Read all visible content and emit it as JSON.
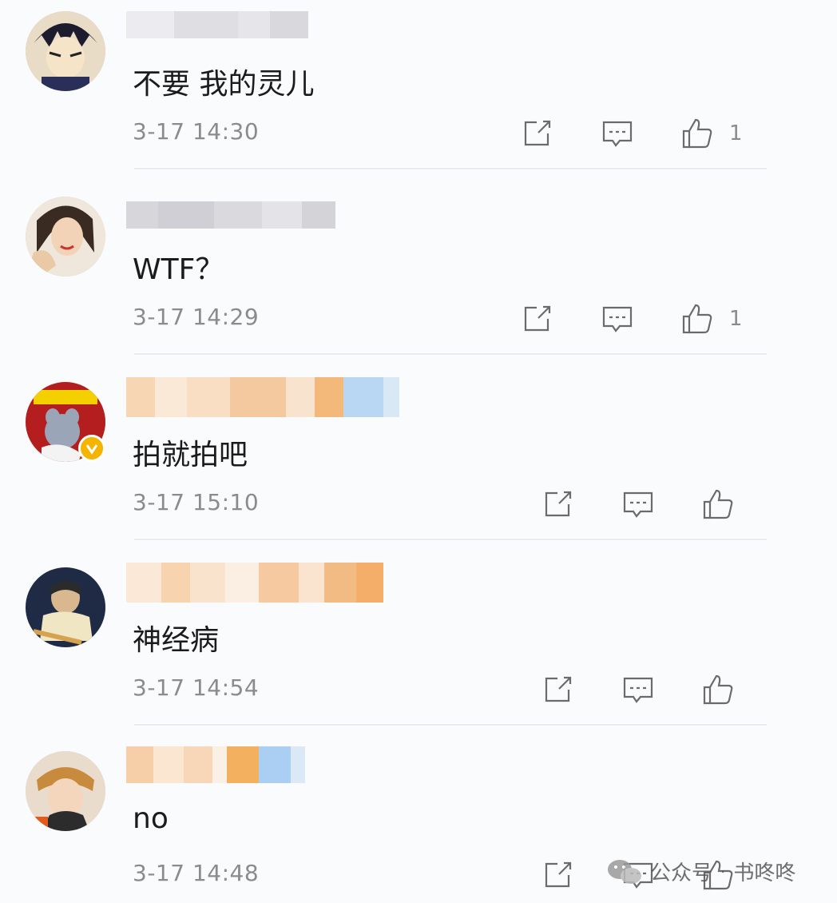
{
  "comments": [
    {
      "text": "不要  我的灵儿",
      "time": "3-17 14:30",
      "likes": "1"
    },
    {
      "text": "WTF？",
      "time": "3-17 14:29",
      "likes": "1"
    },
    {
      "text": "拍就拍吧",
      "time": "3-17 15:10",
      "likes": ""
    },
    {
      "text": "神经病",
      "time": "3-17 14:54",
      "likes": ""
    },
    {
      "text": "no",
      "time": "3-17 14:48",
      "likes": ""
    }
  ],
  "icons": {
    "share": "share-icon",
    "reply": "comment-icon",
    "like": "thumbs-up-icon",
    "verified": "verified-badge-icon"
  },
  "watermark": {
    "label": "公众号",
    "account": "书咚咚"
  },
  "colors": {
    "background": "#fafbfd",
    "icon": "#6b6b6b",
    "meta_text": "#8b8b8b",
    "verified": "#f5b400"
  }
}
